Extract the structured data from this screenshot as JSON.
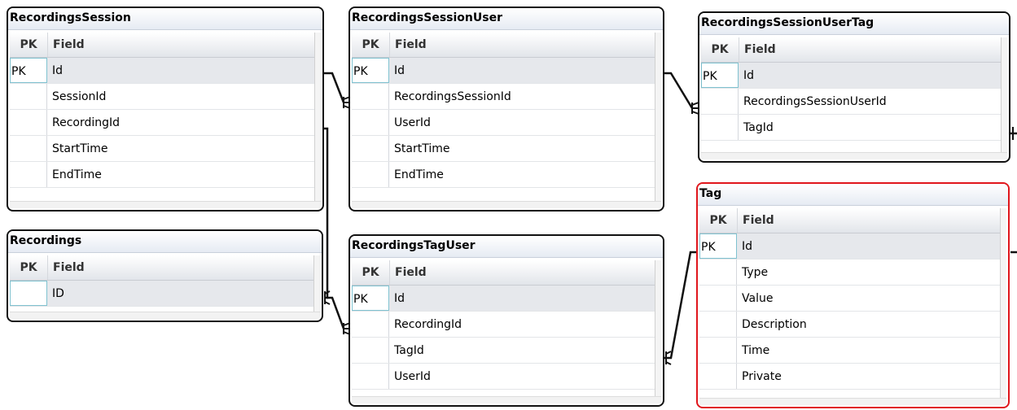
{
  "column_headers": {
    "pk": "PK",
    "field": "Field"
  },
  "tables": [
    {
      "id": "recordings-session",
      "title": "RecordingsSession",
      "rows": [
        {
          "pk": "PK",
          "field": "Id"
        },
        {
          "pk": "",
          "field": "SessionId"
        },
        {
          "pk": "",
          "field": "RecordingId"
        },
        {
          "pk": "",
          "field": "StartTime"
        },
        {
          "pk": "",
          "field": "EndTime"
        }
      ]
    },
    {
      "id": "recordings-session-user",
      "title": "RecordingsSessionUser",
      "rows": [
        {
          "pk": "PK",
          "field": "Id"
        },
        {
          "pk": "",
          "field": "RecordingsSessionId"
        },
        {
          "pk": "",
          "field": "UserId"
        },
        {
          "pk": "",
          "field": "StartTime"
        },
        {
          "pk": "",
          "field": "EndTime"
        }
      ]
    },
    {
      "id": "recordings-session-user-tag",
      "title": "RecordingsSessionUserTag",
      "rows": [
        {
          "pk": "PK",
          "field": "Id"
        },
        {
          "pk": "",
          "field": "RecordingsSessionUserId"
        },
        {
          "pk": "",
          "field": "TagId"
        }
      ]
    },
    {
      "id": "recordings",
      "title": "Recordings",
      "rows": [
        {
          "pk": "",
          "field": "ID"
        }
      ]
    },
    {
      "id": "recordings-tag-user",
      "title": "RecordingsTagUser",
      "rows": [
        {
          "pk": "PK",
          "field": "Id"
        },
        {
          "pk": "",
          "field": "RecordingId"
        },
        {
          "pk": "",
          "field": "TagId"
        },
        {
          "pk": "",
          "field": "UserId"
        }
      ]
    },
    {
      "id": "tag",
      "title": "Tag",
      "rows": [
        {
          "pk": "PK",
          "field": "Id"
        },
        {
          "pk": "",
          "field": "Type"
        },
        {
          "pk": "",
          "field": "Value"
        },
        {
          "pk": "",
          "field": "Description"
        },
        {
          "pk": "",
          "field": "Time"
        },
        {
          "pk": "",
          "field": "Private"
        }
      ]
    }
  ],
  "colors": {
    "border": "#111111",
    "selected_border": "#e0161c",
    "focus_cell": "#7fc2d0"
  }
}
